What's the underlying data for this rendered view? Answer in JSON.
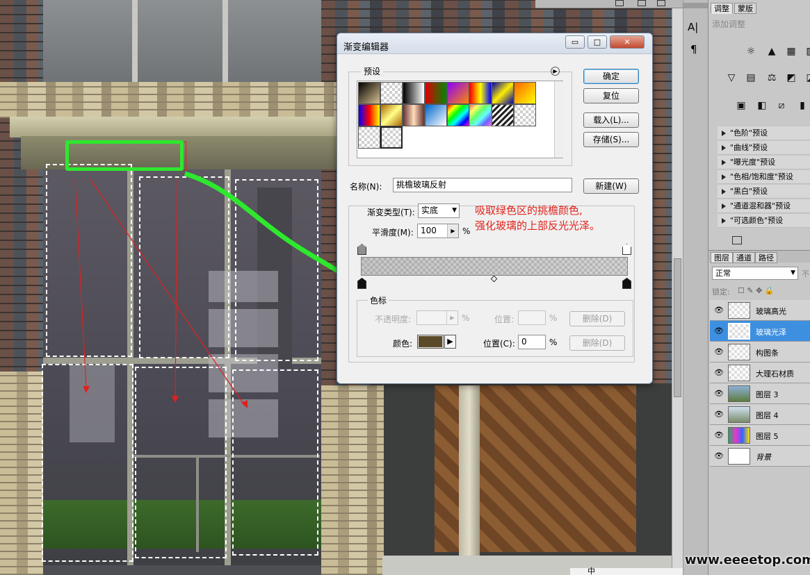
{
  "dialog": {
    "title": "渐变编辑器",
    "presets_label": "预设",
    "buttons": {
      "ok": "确定",
      "reset": "复位",
      "load": "载入(L)...",
      "save": "存储(S)...",
      "new": "新建(W)"
    },
    "name_label": "名称(N):",
    "name_value": "挑檐玻璃反射",
    "gradient_type_label": "渐变类型(T):",
    "gradient_type_value": "实底",
    "smoothness_label": "平滑度(M):",
    "smoothness_value": "100",
    "percent": "%",
    "stops_label": "色标",
    "opacity_label": "不透明度:",
    "location_label": "位置:",
    "location_c_label": "位置(C):",
    "location_c_value": "0",
    "delete_label": "删除(D)",
    "color_label": "颜色:",
    "stop_color": "#5a4a28"
  },
  "annotation": {
    "line1": "吸取绿色区的挑檐颜色,",
    "line2": "强化玻璃的上部反光光泽。",
    "arrow_color": "#2ee82e",
    "text_color": "#e0231b"
  },
  "right_panel": {
    "tabs": [
      "调整",
      "蒙版"
    ],
    "add_adjustment": "添加调整",
    "presets": [
      "\"色阶\"预设",
      "\"曲线\"预设",
      "\"曝光度\"预设",
      "\"色相/饱和度\"预设",
      "\"黑白\"预设",
      "\"通道混和器\"预设",
      "\"可选颜色\"预设"
    ],
    "layer_tabs": [
      "图层",
      "通道",
      "路径"
    ],
    "blend_mode": "正常",
    "opacity_short": "不",
    "lock_label": "锁定:",
    "layers": [
      "玻璃高光",
      "玻璃光泽",
      "构图条",
      "大理石材质",
      "图层 3",
      "图层 4",
      "图层 5",
      "背景"
    ],
    "selected_layer": "玻璃光泽"
  },
  "tools": {
    "char_icon": "A|",
    "para_icon": "¶"
  },
  "watermark": "www.eeeetop.com",
  "taskbar_text": "中"
}
